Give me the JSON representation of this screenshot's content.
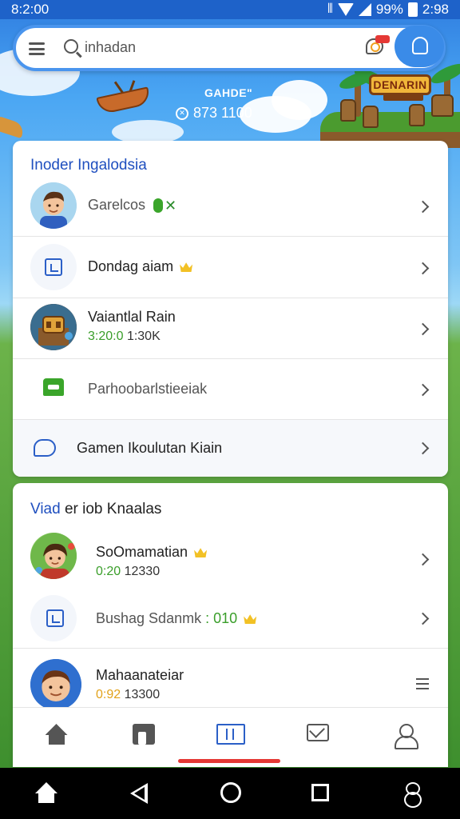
{
  "status_bar": {
    "time": "8:2:00",
    "battery_text": "99%",
    "clock_right": "2:98"
  },
  "search": {
    "placeholder": "inhadan"
  },
  "game_banner": {
    "label": "GAHDE\"",
    "balance": "873 1100",
    "title": "DENARIN"
  },
  "section1": {
    "title": "Inoder Ingalodsia",
    "items": [
      {
        "title": "Garelcos",
        "icon": "avatar-boy"
      },
      {
        "title": "Dondag aiam",
        "icon": "tablet-icon"
      },
      {
        "title": "Vaiantlal Rain",
        "sub_green": "3:20:0",
        "sub_rest": "1:30K",
        "icon": "game-thumb"
      },
      {
        "title": "Parhoobarlstieeiak",
        "icon": "android-icon"
      },
      {
        "title": "Gamen Ikoulutan Kiain",
        "icon": "chat-icon"
      }
    ]
  },
  "section2": {
    "title_blue": "Viad",
    "title_rest": " er iob Knaalas",
    "items": [
      {
        "title": "SoOmamatian",
        "sub_green": "0:20",
        "sub_rest": "12330",
        "icon": "avatar-girl"
      },
      {
        "title": "Bushag Sdanmk",
        "title_suffix": ": 010",
        "icon": "tablet-icon"
      },
      {
        "title": "Mahaanateiar",
        "sub_green": "0:92",
        "sub_rest": "13300",
        "icon": "avatar-man"
      }
    ]
  },
  "tabs": [
    "home",
    "store",
    "grid",
    "mail",
    "profile"
  ],
  "colors": {
    "accent": "#2b5fc7",
    "status_bar": "#1e62c9",
    "indicator": "#e53935",
    "green": "#3a9e2a",
    "crown": "#f2c125"
  }
}
